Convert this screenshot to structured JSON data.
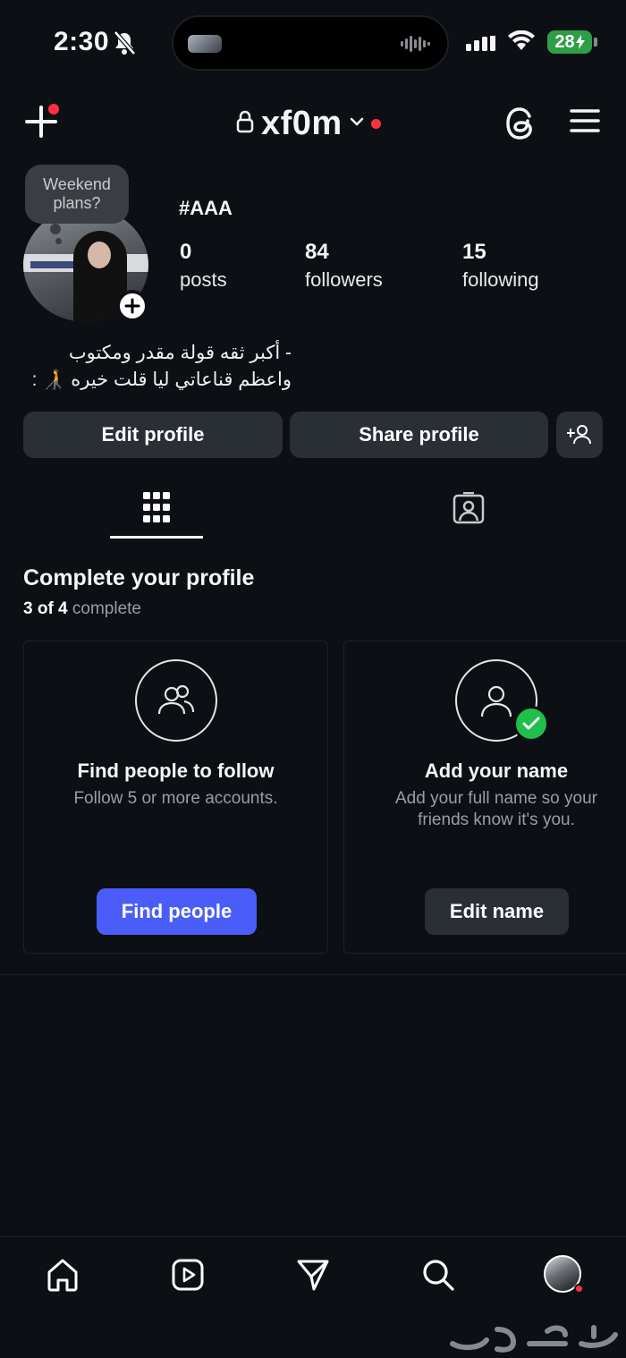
{
  "status_bar": {
    "time": "2:30",
    "battery": "28"
  },
  "header": {
    "username": "xf0m"
  },
  "profile": {
    "note": "Weekend plans?",
    "tagline": "#AAA",
    "stats": [
      {
        "value": "0",
        "label": "posts"
      },
      {
        "value": "84",
        "label": "followers"
      },
      {
        "value": "15",
        "label": "following"
      }
    ],
    "bio_lines": [
      "- أكبر ثقه قولة مقدر ومكتوب",
      "واعظم قناعاتي ليا قلت خيره 🧑‍🦯 :"
    ]
  },
  "actions": {
    "edit_profile": "Edit profile",
    "share_profile": "Share profile"
  },
  "complete_profile": {
    "title": "Complete your profile",
    "progress_count": "3 of 4",
    "progress_word": "complete",
    "cards": [
      {
        "title": "Find people to follow",
        "subtitle": "Follow 5 or more accounts.",
        "button": "Find people",
        "icon": "people-icon",
        "done": false
      },
      {
        "title": "Add your name",
        "subtitle": "Add your full name so your friends know it's you.",
        "button": "Edit name",
        "icon": "person-icon",
        "done": true
      }
    ]
  },
  "bottom_nav": [
    "home-icon",
    "reels-icon",
    "direct-icon",
    "search-icon",
    "profile-avatar"
  ],
  "colors": {
    "background": "#0c0f14",
    "button": "#2a2e35",
    "primary": "#4a5df9",
    "notification": "#ff3040",
    "success": "#1fbf4a"
  }
}
